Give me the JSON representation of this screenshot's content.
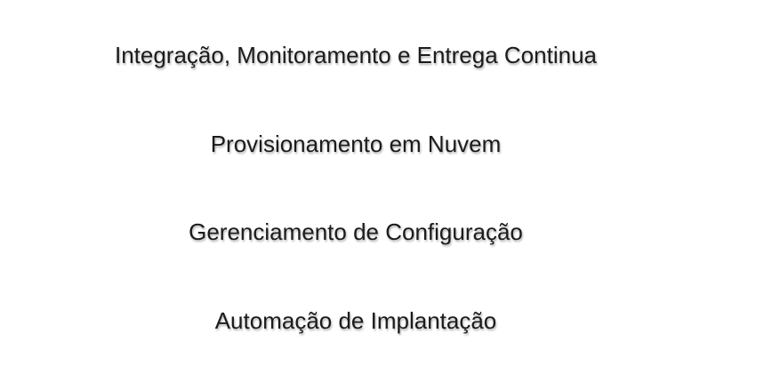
{
  "lines": [
    "Integração, Monitoramento e Entrega Continua",
    "Provisionamento em Nuvem",
    "Gerenciamento de Configuração",
    "Automação de Implantação"
  ]
}
